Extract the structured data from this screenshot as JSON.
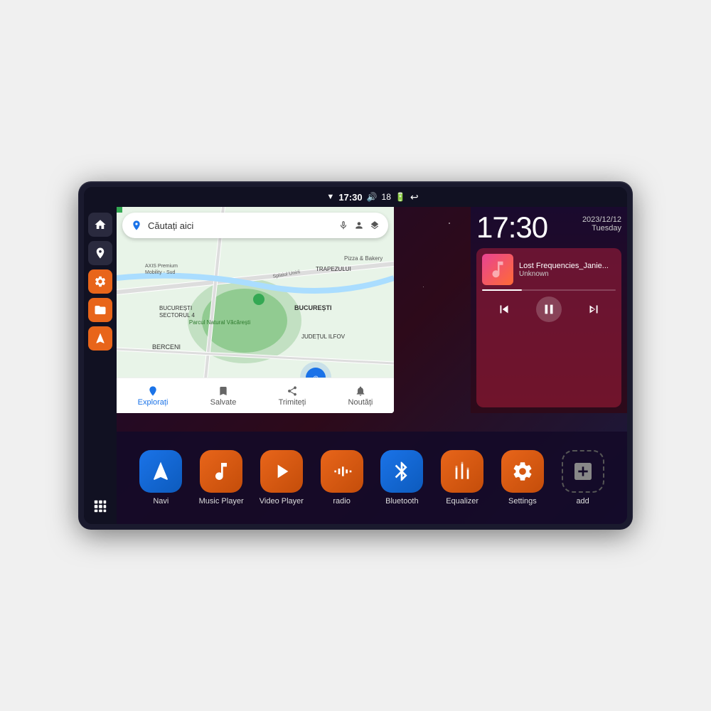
{
  "device": {
    "status_bar": {
      "time": "17:30",
      "battery": "18",
      "wifi_icon": "wifi",
      "volume_icon": "volume",
      "battery_icon": "battery",
      "back_icon": "back"
    },
    "clock": {
      "time": "17:30",
      "date": "2023/12/12",
      "weekday": "Tuesday"
    },
    "map": {
      "search_placeholder": "Căutați aici",
      "locations": [
        "AXIS Premium Mobility - Sud",
        "Pizza & Bakery",
        "Parcul Natural Văcărești",
        "BUCUREȘTI SECTORUL 4",
        "BUCUREȘTI",
        "JUDEȚUL ILFOV",
        "BERCENI"
      ],
      "bottom_items": [
        {
          "label": "Explorați",
          "active": true
        },
        {
          "label": "Salvate",
          "active": false
        },
        {
          "label": "Trimiteți",
          "active": false
        },
        {
          "label": "Noutăți",
          "active": false
        }
      ]
    },
    "music": {
      "title": "Lost Frequencies_Janie...",
      "artist": "Unknown",
      "progress": 30
    },
    "apps": [
      {
        "id": "navi",
        "label": "Navi",
        "icon_type": "navi"
      },
      {
        "id": "music-player",
        "label": "Music Player",
        "icon_type": "music"
      },
      {
        "id": "video-player",
        "label": "Video Player",
        "icon_type": "video"
      },
      {
        "id": "radio",
        "label": "radio",
        "icon_type": "radio"
      },
      {
        "id": "bluetooth",
        "label": "Bluetooth",
        "icon_type": "bluetooth"
      },
      {
        "id": "equalizer",
        "label": "Equalizer",
        "icon_type": "equalizer"
      },
      {
        "id": "settings",
        "label": "Settings",
        "icon_type": "settings"
      },
      {
        "id": "add",
        "label": "add",
        "icon_type": "add"
      }
    ]
  }
}
